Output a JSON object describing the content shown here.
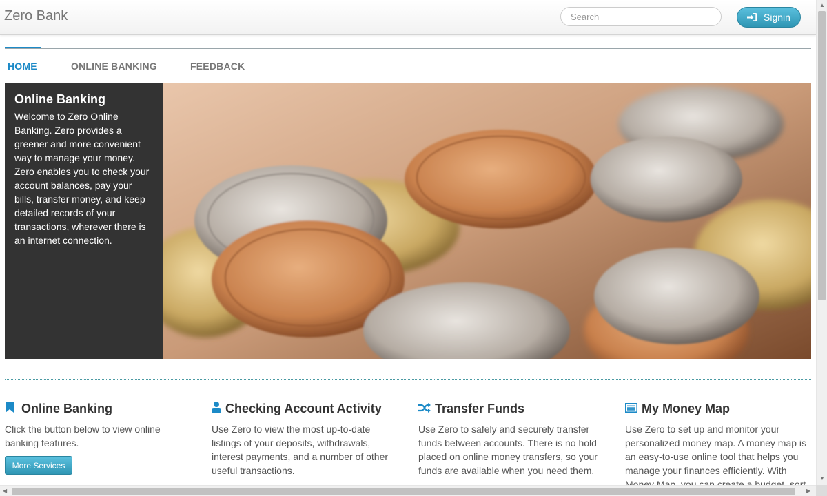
{
  "navbar": {
    "brand": "Zero Bank",
    "search_placeholder": "Search",
    "signin_label": "Signin"
  },
  "tabs": [
    {
      "label": "HOME",
      "active": true
    },
    {
      "label": "ONLINE BANKING",
      "active": false
    },
    {
      "label": "FEEDBACK",
      "active": false
    }
  ],
  "hero": {
    "title": "Online Banking",
    "text": "Welcome to Zero Online Banking. Zero provides a greener and more convenient way to manage your money. Zero enables you to check your account balances, pay your bills, transfer money, and keep detailed records of your transactions, wherever there is an internet connection."
  },
  "features": [
    {
      "icon": "bookmark-icon",
      "title": "Online Banking",
      "text": "Click the button below to view online banking features.",
      "button": "More Services"
    },
    {
      "icon": "user-icon",
      "title": "Checking Account Activity",
      "text": "Use Zero to view the most up-to-date listings of your deposits, withdrawals, interest payments, and a number of other useful transactions."
    },
    {
      "icon": "shuffle-icon",
      "title": "Transfer Funds",
      "text": "Use Zero to safely and securely transfer funds between accounts. There is no hold placed on online money transfers, so your funds are available when you need them."
    },
    {
      "icon": "list-alt-icon",
      "title": "My Money Map",
      "text": "Use Zero to set up and monitor your personalized money map. A money map is an easy-to-use online tool that helps you manage your finances efficiently. With Money Map, you can create a budget, sort"
    }
  ],
  "colors": {
    "accent": "#1c8ac7",
    "button": "#2f96b4",
    "hero_panel": "#333333"
  }
}
